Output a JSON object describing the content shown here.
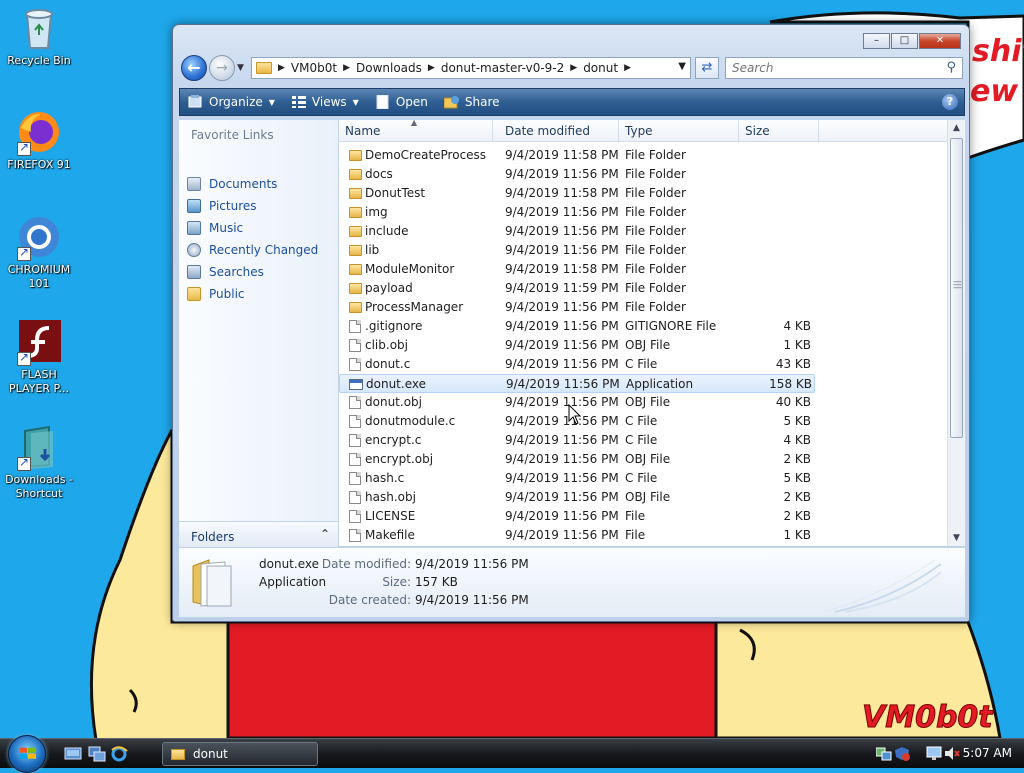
{
  "desktop": {
    "wallpaper_texts": {
      "shit": "shit",
      "ew": "ew",
      "signature": "VM0b0t"
    },
    "icons": [
      {
        "label": "Recycle Bin",
        "icon": "recycle-bin-icon"
      },
      {
        "label": "FIREFOX 91",
        "icon": "firefox-icon"
      },
      {
        "label": "CHROMIUM 101",
        "icon": "chromium-icon"
      },
      {
        "label": "FLASH PLAYER P...",
        "icon": "flash-player-icon"
      },
      {
        "label": "Downloads - Shortcut",
        "icon": "downloads-shortcut-icon"
      }
    ]
  },
  "window": {
    "controls": {
      "minimize": "–",
      "maximize": "□",
      "close": "✕"
    },
    "address": {
      "crumbs": [
        "VM0b0t",
        "Downloads",
        "donut-master-v0-9-2",
        "donut"
      ],
      "separator": "▶"
    },
    "search": {
      "placeholder": "Search"
    },
    "toolbar": {
      "organize": "Organize",
      "views": "Views",
      "open": "Open",
      "share": "Share"
    },
    "nav_pane": {
      "title": "Favorite Links",
      "links": [
        "Documents",
        "Pictures",
        "Music",
        "Recently Changed",
        "Searches",
        "Public"
      ],
      "folders_label": "Folders"
    },
    "columns": {
      "name": "Name",
      "date": "Date modified",
      "type": "Type",
      "size": "Size"
    },
    "files": [
      {
        "name": "DemoCreateProcess",
        "date": "9/4/2019 11:58 PM",
        "type": "File Folder",
        "size": "",
        "kind": "folder"
      },
      {
        "name": "docs",
        "date": "9/4/2019 11:56 PM",
        "type": "File Folder",
        "size": "",
        "kind": "folder"
      },
      {
        "name": "DonutTest",
        "date": "9/4/2019 11:58 PM",
        "type": "File Folder",
        "size": "",
        "kind": "folder"
      },
      {
        "name": "img",
        "date": "9/4/2019 11:56 PM",
        "type": "File Folder",
        "size": "",
        "kind": "folder"
      },
      {
        "name": "include",
        "date": "9/4/2019 11:56 PM",
        "type": "File Folder",
        "size": "",
        "kind": "folder"
      },
      {
        "name": "lib",
        "date": "9/4/2019 11:56 PM",
        "type": "File Folder",
        "size": "",
        "kind": "folder"
      },
      {
        "name": "ModuleMonitor",
        "date": "9/4/2019 11:58 PM",
        "type": "File Folder",
        "size": "",
        "kind": "folder"
      },
      {
        "name": "payload",
        "date": "9/4/2019 11:59 PM",
        "type": "File Folder",
        "size": "",
        "kind": "folder"
      },
      {
        "name": "ProcessManager",
        "date": "9/4/2019 11:56 PM",
        "type": "File Folder",
        "size": "",
        "kind": "folder"
      },
      {
        "name": ".gitignore",
        "date": "9/4/2019 11:56 PM",
        "type": "GITIGNORE File",
        "size": "4 KB",
        "kind": "doc"
      },
      {
        "name": "clib.obj",
        "date": "9/4/2019 11:56 PM",
        "type": "OBJ File",
        "size": "1 KB",
        "kind": "doc"
      },
      {
        "name": "donut.c",
        "date": "9/4/2019 11:56 PM",
        "type": "C File",
        "size": "43 KB",
        "kind": "doc"
      },
      {
        "name": "donut.exe",
        "date": "9/4/2019 11:56 PM",
        "type": "Application",
        "size": "158 KB",
        "kind": "app",
        "selected": true
      },
      {
        "name": "donut.obj",
        "date": "9/4/2019 11:56 PM",
        "type": "OBJ File",
        "size": "40 KB",
        "kind": "doc"
      },
      {
        "name": "donutmodule.c",
        "date": "9/4/2019 11:56 PM",
        "type": "C File",
        "size": "5 KB",
        "kind": "doc"
      },
      {
        "name": "encrypt.c",
        "date": "9/4/2019 11:56 PM",
        "type": "C File",
        "size": "4 KB",
        "kind": "doc"
      },
      {
        "name": "encrypt.obj",
        "date": "9/4/2019 11:56 PM",
        "type": "OBJ File",
        "size": "2 KB",
        "kind": "doc"
      },
      {
        "name": "hash.c",
        "date": "9/4/2019 11:56 PM",
        "type": "C File",
        "size": "5 KB",
        "kind": "doc"
      },
      {
        "name": "hash.obj",
        "date": "9/4/2019 11:56 PM",
        "type": "OBJ File",
        "size": "2 KB",
        "kind": "doc"
      },
      {
        "name": "LICENSE",
        "date": "9/4/2019 11:56 PM",
        "type": "File",
        "size": "2 KB",
        "kind": "doc"
      },
      {
        "name": "Makefile",
        "date": "9/4/2019 11:56 PM",
        "type": "File",
        "size": "1 KB",
        "kind": "doc"
      }
    ],
    "details": {
      "name": "donut.exe",
      "kind": "Application",
      "modified_label": "Date modified:",
      "modified": "9/4/2019 11:56 PM",
      "size_label": "Size:",
      "size": "157 KB",
      "created_label": "Date created:",
      "created": "9/4/2019 11:56 PM"
    }
  },
  "taskbar": {
    "task_label": "donut",
    "clock": "5:07 AM"
  },
  "colors": {
    "desktop_bg": "#1ea7ea",
    "wall_red": "#e21b24",
    "wall_yellow": "#fde99b",
    "selection": "#d5e8fb",
    "link_blue": "#1b4f9c"
  }
}
